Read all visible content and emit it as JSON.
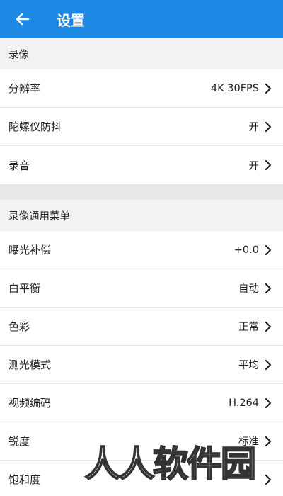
{
  "appbar": {
    "title": "设置",
    "back_icon": "arrow-left-icon",
    "color": "#1e88e5"
  },
  "sections": [
    {
      "header": "录像",
      "rows": [
        {
          "label": "分辨率",
          "value": "4K 30FPS"
        },
        {
          "label": "陀螺仪防抖",
          "value": "开"
        },
        {
          "label": "录音",
          "value": "开"
        }
      ]
    },
    {
      "header": "录像通用菜单",
      "rows": [
        {
          "label": "曝光补偿",
          "value": "+0.0"
        },
        {
          "label": "白平衡",
          "value": "自动"
        },
        {
          "label": "色彩",
          "value": "正常"
        },
        {
          "label": "测光模式",
          "value": "平均"
        },
        {
          "label": "视频编码",
          "value": "H.264"
        },
        {
          "label": "锐度",
          "value": "标准"
        },
        {
          "label": "饱和度",
          "value": ""
        }
      ]
    }
  ],
  "watermark": "人人软件园"
}
